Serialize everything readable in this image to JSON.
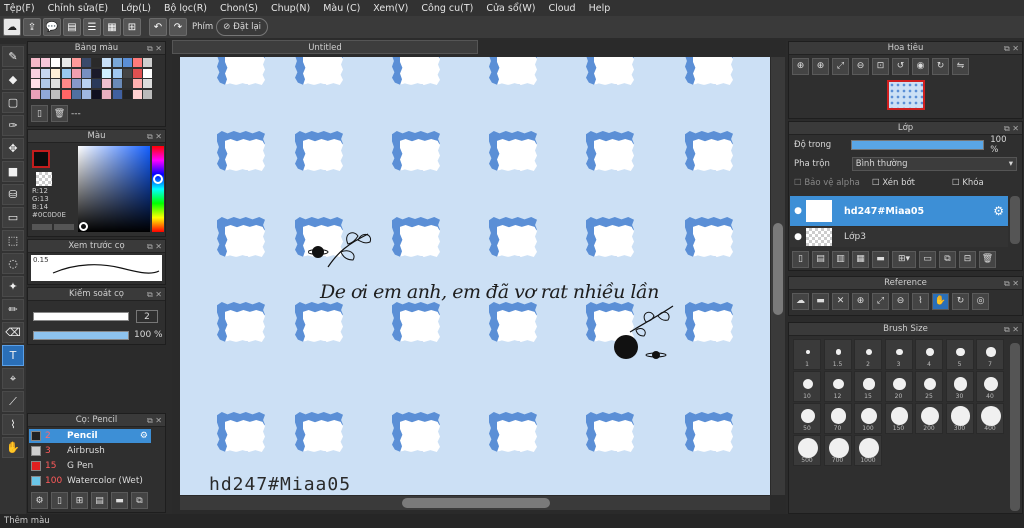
{
  "menu": [
    "Tệp(F)",
    "Chỉnh sửa(E)",
    "Lớp(L)",
    "Bộ lọc(R)",
    "Chon(S)",
    "Chup(N)",
    "Màu (C)",
    "Xem(V)",
    "Công cu(T)",
    "Cửa sổ(W)",
    "Cloud",
    "Help"
  ],
  "toolbar": {
    "brush_label": "Phím",
    "reset_label": "Đặt lại"
  },
  "panels": {
    "palette": "Bảng màu",
    "palette_extra": "---",
    "color": "Màu",
    "color_values": {
      "r": "R:12",
      "g": "G:13",
      "b": "B:14",
      "hex": "#0C0D0E"
    },
    "preview": "Xem trước cọ",
    "preview_value": "0.15",
    "control": "Kiếm soát cọ",
    "control_size": "2",
    "control_opacity": "100 %",
    "brush_list": "Cọ: Pencil",
    "navigator": "Hoa tiêu",
    "layer": "Lớp",
    "reference": "Reference",
    "brush_size": "Brush Size"
  },
  "brushes": [
    {
      "size": "2",
      "name": "Pencil",
      "color": "#222222",
      "selected": true
    },
    {
      "size": "3",
      "name": "Airbrush",
      "color": "#d0d0d0",
      "selected": false
    },
    {
      "size": "15",
      "name": "G Pen",
      "color": "#e02020",
      "selected": false
    },
    {
      "size": "100",
      "name": "Watercolor (Wet)",
      "color": "#6ac6e8",
      "selected": false
    }
  ],
  "doc_tab": "Untitled",
  "canvas": {
    "watermark": "hd247#Miaa05",
    "script": "De ơi em anh, em đã vơ rat nhiều lần"
  },
  "layer_panel": {
    "opacity_label": "Độ trong",
    "opacity_value": "100 %",
    "blend_label": "Pha trộn",
    "blend_value": "Bình thường",
    "protect_alpha": "Bảo vệ alpha",
    "clip": "Xén bớt",
    "lock": "Khóa",
    "layers": [
      {
        "name": "hd247#Miaa05",
        "selected": true
      },
      {
        "name": "Lớp3",
        "selected": false
      }
    ]
  },
  "brush_sizes": [
    "1",
    "1.5",
    "2",
    "3",
    "4",
    "5",
    "7",
    "10",
    "12",
    "15",
    "20",
    "25",
    "30",
    "40",
    "50",
    "70",
    "100",
    "150",
    "200",
    "300",
    "400",
    "500",
    "700",
    "1000"
  ],
  "status": "Thêm màu",
  "colors": {
    "accent": "#2a6fb8",
    "canvas_bg": "#cce0f5",
    "tile_blue": "#5b8fd6",
    "fg_color": "#0C0D0E"
  }
}
